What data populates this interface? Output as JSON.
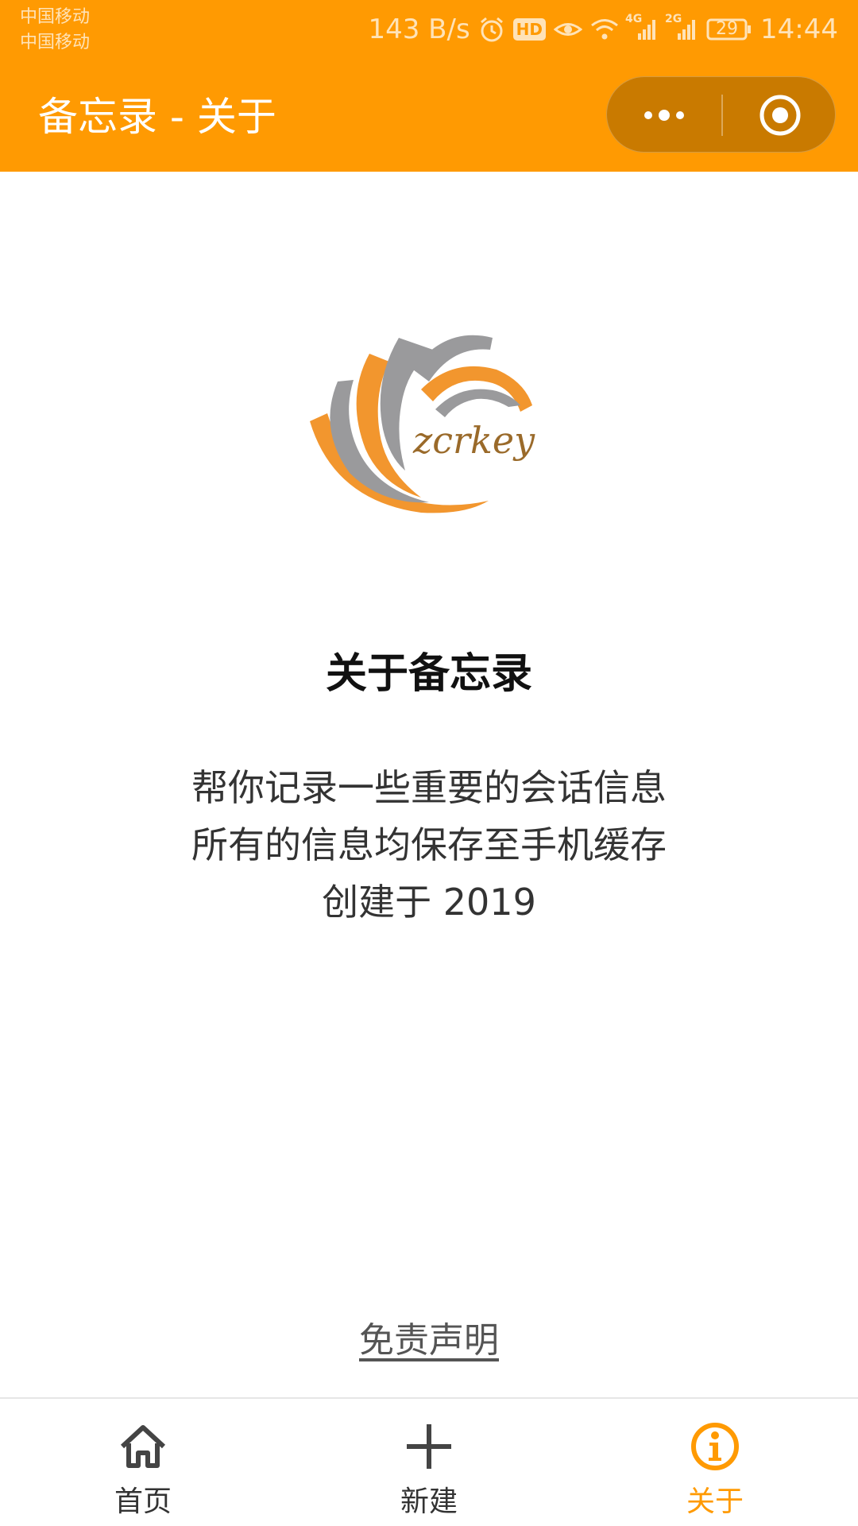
{
  "status_bar": {
    "carrier_1": "中国移动",
    "carrier_2": "中国移动",
    "speed": "143 B/s",
    "hd_badge": "HD",
    "signal_1_type": "4G",
    "signal_2_type": "2G",
    "battery": "29",
    "time": "14:44"
  },
  "header": {
    "title": "备忘录 - 关于",
    "more_icon": "ellipsis-icon",
    "close_icon": "target-circle-icon"
  },
  "logo": {
    "text": "zcrkey"
  },
  "about": {
    "title": "关于备忘录",
    "lines": [
      "帮你记录一些重要的会话信息",
      "所有的信息均保存至手机缓存",
      "创建于 2019"
    ]
  },
  "disclaimer_label": "免责声明",
  "tabbar": {
    "tabs": [
      {
        "label": "首页",
        "icon": "home-icon"
      },
      {
        "label": "新建",
        "icon": "plus-icon"
      },
      {
        "label": "关于",
        "icon": "info-icon",
        "active": true
      }
    ]
  },
  "colors": {
    "accent": "#FF9A02",
    "logo_gray": "#9A9A9C"
  }
}
